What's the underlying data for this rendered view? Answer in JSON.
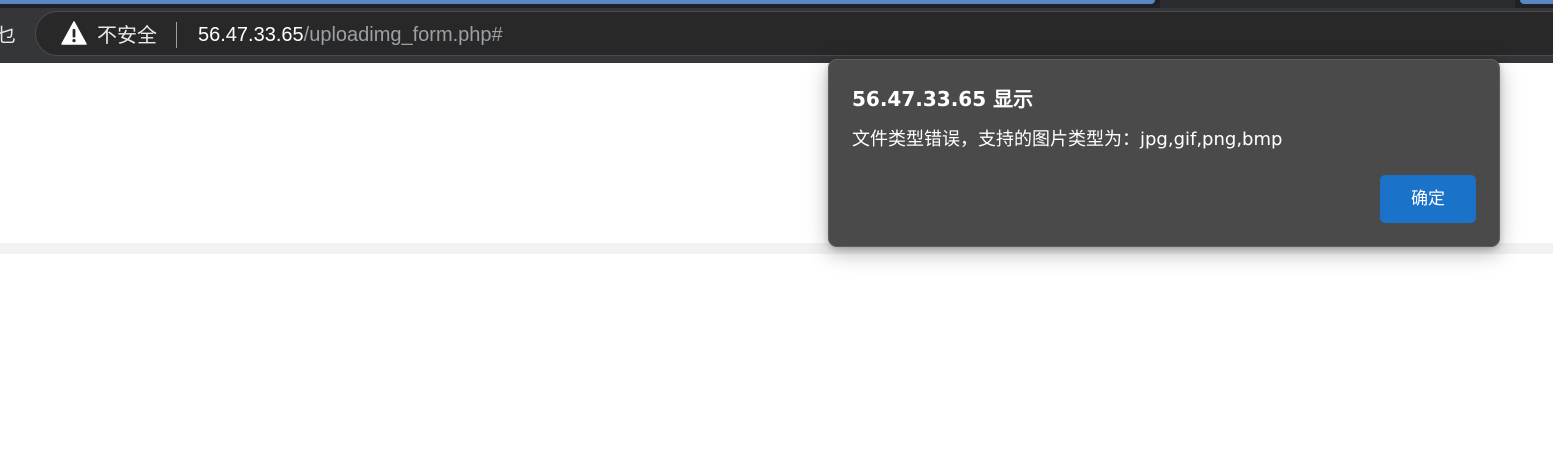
{
  "browser": {
    "left_glyph": "乜",
    "security_label": "不安全",
    "security_icon": "warning-triangle-icon",
    "url_host": "56.47.33.65",
    "url_path": "/uploadimg_form.php#"
  },
  "dialog": {
    "title": "56.47.33.65 显示",
    "message": "文件类型错误，支持的图片类型为：jpg,gif,png,bmp",
    "ok_label": "确定"
  },
  "colors": {
    "toolbar": "#35363a",
    "omnibox": "#282828",
    "tab_accent": "#5a86c4",
    "dialog_bg": "#4a4a4a",
    "ok_button": "#1a72c9"
  }
}
